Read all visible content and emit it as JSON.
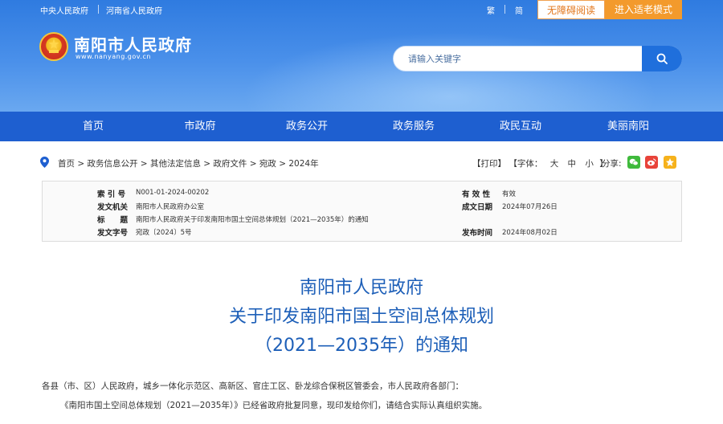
{
  "topbar": {
    "links": [
      "中央人民政府",
      "河南省人民政府"
    ],
    "lang_trad": "繁",
    "lang_simp": "简",
    "accessible_btn": "无障碍阅读",
    "elder_btn": "进入适老模式"
  },
  "site": {
    "title": "南阳市人民政府",
    "domain": "www.nanyang.gov.cn"
  },
  "search": {
    "placeholder": "请输入关键字"
  },
  "nav": {
    "items": [
      "首页",
      "市政府",
      "政务公开",
      "政务服务",
      "政民互动",
      "美丽南阳"
    ]
  },
  "breadcrumb": {
    "text": "首页 > 政务信息公开 > 其他法定信息 > 政府文件 > 宛政 > 2024年"
  },
  "tools": {
    "print": "【打印】",
    "font_label": "【字体：",
    "font_large": "大",
    "font_mid": "中",
    "font_small": "小",
    "font_end": "】",
    "share_label": "分享:"
  },
  "meta": {
    "index_label": "索 引 号",
    "index_value": "N001-01-2024-00202",
    "validity_label": "有 效 性",
    "validity_value": "有效",
    "issuer_label": "发文机关",
    "issuer_value": "南阳市人民政府办公室",
    "date_label": "成文日期",
    "date_value": "2024年07月26日",
    "title_label": "标　　题",
    "title_value": "南阳市人民政府关于印发南阳市国土空间总体规划（2021—2035年）的通知",
    "docno_label": "发文字号",
    "docno_value": "宛政〔2024〕5号",
    "pub_label": "发布时间",
    "pub_value": "2024年08月02日"
  },
  "doc": {
    "title_line1": "南阳市人民政府",
    "title_line2": "关于印发南阳市国土空间总体规划",
    "title_line3": "（2021—2035年）的通知",
    "para1": "各县（市、区）人民政府，城乡一体化示范区、高新区、官庄工区、卧龙综合保税区管委会，市人民政府各部门：",
    "para2": "《南阳市国土空间总体规划（2021—2035年）》已经省政府批复同意，现印发给你们，请结合实际认真组织实施。"
  },
  "colors": {
    "header_blue": "#2f7be0",
    "nav_blue": "#1e5fd0",
    "title_blue": "#1d5fb8",
    "elder_orange": "#f39a2c"
  }
}
